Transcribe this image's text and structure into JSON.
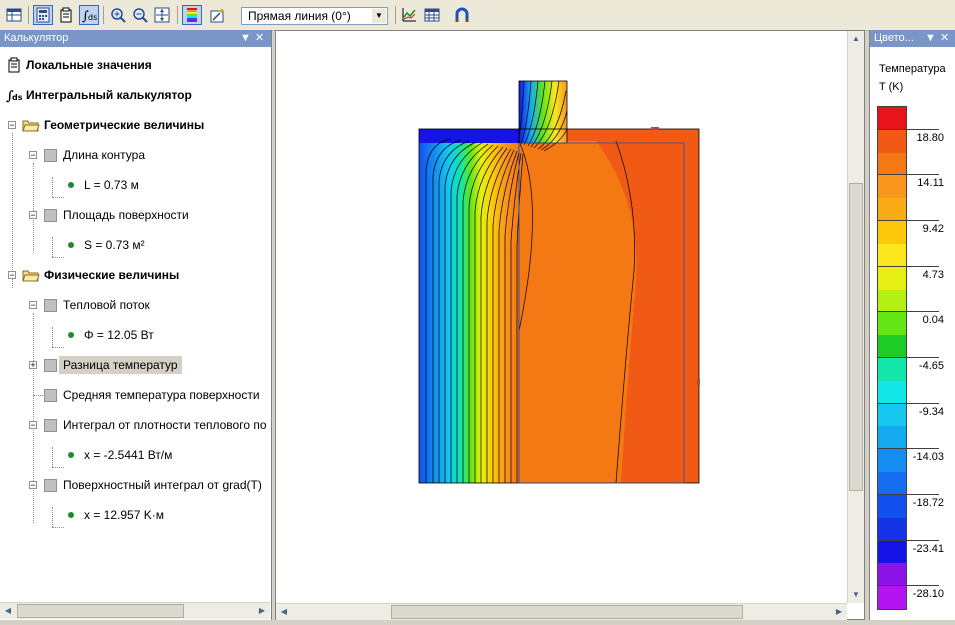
{
  "toolbar": {
    "line_type_select": "Прямая линия (0°)",
    "icons": [
      "table-icon",
      "calculator-icon",
      "local-values-icon",
      "integral-icon",
      "zoom-in-icon",
      "zoom-out-icon",
      "zoom-fit-icon",
      "color-scale-icon",
      "magic-wand-icon",
      "plot-icon",
      "grid-table-icon",
      "magnet-icon"
    ]
  },
  "left_panel": {
    "title": "Калькулятор",
    "tree": {
      "local_values": "Локальные значения",
      "integral_calc": "Интегральный калькулятор",
      "geometric": {
        "label": "Геометрические величины",
        "contour_length": "Длина контура",
        "contour_length_value": "L = 0.73 м",
        "surface_area": "Площадь поверхности",
        "surface_area_value": "S = 0.73 м²"
      },
      "physical": {
        "label": "Физические величины",
        "heat_flow": "Тепловой поток",
        "heat_flow_value": "Φ = 12.05 Вт",
        "temp_diff": "Разница температур",
        "avg_surface_temp": "Средняя температура поверхности",
        "heat_flux_integral": "Интеграл от плотности теплового по",
        "heat_flux_integral_value": "x = -2.5441 Вт/м",
        "grad_integral": "Поверхностный интеграл от grad(T)",
        "grad_integral_value": "x = 12.957 K·м"
      }
    }
  },
  "color_panel": {
    "title": "Цвето...",
    "quantity": "Температура",
    "unit": "T (K)",
    "labels": [
      "18.80",
      "14.11",
      "9.42",
      "4.73",
      "0.04",
      "-4.65",
      "-9.34",
      "-14.03",
      "-18.72",
      "-23.41",
      "-28.10"
    ],
    "colors": [
      "#e8141c",
      "#f05a14",
      "#f47814",
      "#f8961e",
      "#faaa14",
      "#fcc80a",
      "#fce61e",
      "#e6f014",
      "#b4f014",
      "#64e614",
      "#1ecc28",
      "#14e6aa",
      "#14e6e6",
      "#14c8f0",
      "#14aaf0",
      "#148cf0",
      "#146ef0",
      "#1450f0",
      "#1432e6",
      "#1414e6",
      "#8c14e6",
      "#b414f0"
    ]
  }
}
